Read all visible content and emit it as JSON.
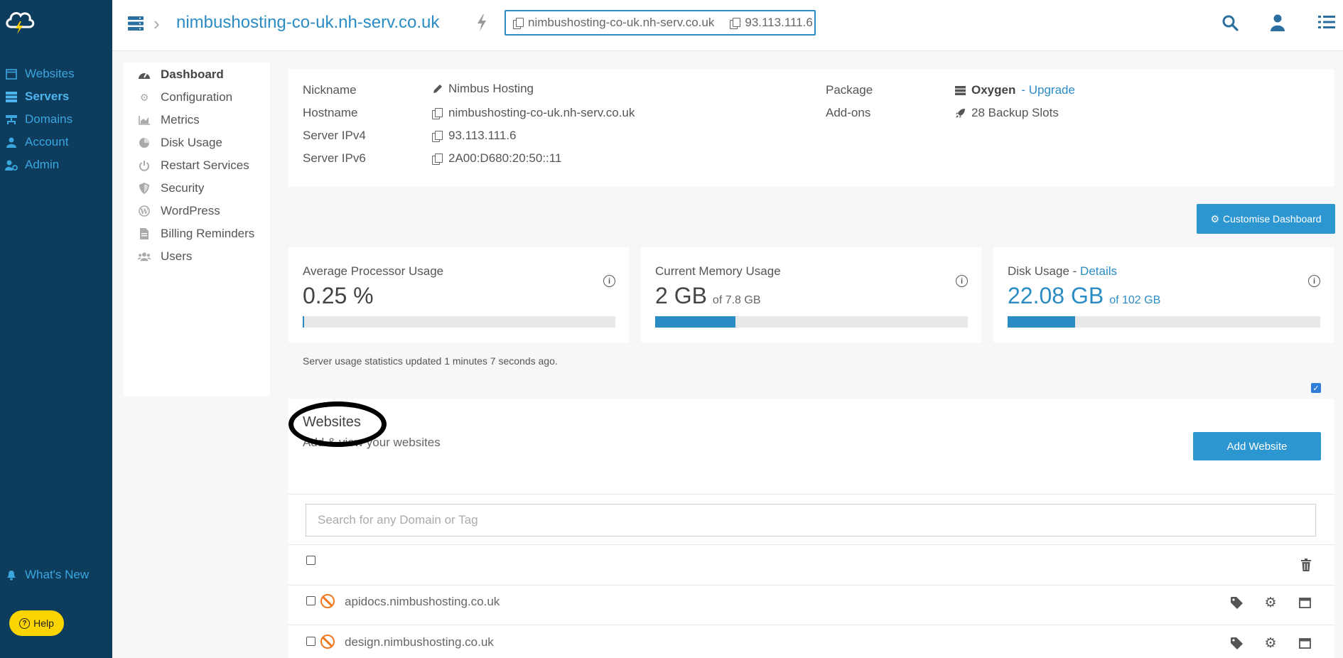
{
  "colors": {
    "nav_bg": "#0d3c5c",
    "accent": "#2b8cc4",
    "help": "#fcd500",
    "warning": "#f07820"
  },
  "leftnav": {
    "items": [
      {
        "label": "Websites",
        "icon": "browser-icon"
      },
      {
        "label": "Servers",
        "icon": "server-icon",
        "active": true
      },
      {
        "label": "Domains",
        "icon": "sitemap-icon"
      },
      {
        "label": "Account",
        "icon": "user-icon"
      },
      {
        "label": "Admin",
        "icon": "user-cog-icon"
      }
    ],
    "whats_new": "What's New",
    "help": "Help"
  },
  "topbar": {
    "title": "nimbushosting-co-uk.nh-serv.co.uk",
    "copy_hostname": "nimbushosting-co-uk.nh-serv.co.uk",
    "copy_ip": "93.113.111.6"
  },
  "subnav": {
    "items": [
      {
        "label": "Dashboard",
        "icon": "gauge-icon",
        "active": true
      },
      {
        "label": "Configuration",
        "icon": "cogs-icon"
      },
      {
        "label": "Metrics",
        "icon": "chart-area-icon"
      },
      {
        "label": "Disk Usage",
        "icon": "pie-chart-icon"
      },
      {
        "label": "Restart Services",
        "icon": "power-icon"
      },
      {
        "label": "Security",
        "icon": "shield-icon"
      },
      {
        "label": "WordPress",
        "icon": "wordpress-icon"
      },
      {
        "label": "Billing Reminders",
        "icon": "invoice-icon"
      },
      {
        "label": "Users",
        "icon": "users-icon"
      }
    ]
  },
  "info": {
    "nickname_label": "Nickname",
    "nickname": "Nimbus Hosting",
    "hostname_label": "Hostname",
    "hostname": "nimbushosting-co-uk.nh-serv.co.uk",
    "ipv4_label": "Server IPv4",
    "ipv4": "93.113.111.6",
    "ipv6_label": "Server IPv6",
    "ipv6": "2A00:D680:20:50::11",
    "package_label": "Package",
    "package": "Oxygen",
    "upgrade": "- Upgrade",
    "addons_label": "Add-ons",
    "addons": "28 Backup Slots"
  },
  "customise_button": "Customise Dashboard",
  "stats": {
    "cpu": {
      "title": "Average Processor Usage",
      "value": "0.25 %",
      "fill": 0.0025
    },
    "memory": {
      "title": "Current Memory Usage",
      "value": "2 GB",
      "of": "of 7.8 GB",
      "fill": 0.256
    },
    "disk": {
      "title_prefix": "Disk Usage -",
      "details": "Details",
      "value": "22.08 GB",
      "of": "of 102 GB",
      "fill": 0.2165
    },
    "note": "Server usage statistics updated 1 minutes 7 seconds ago."
  },
  "websites": {
    "title": "Websites",
    "subtitle": "Add & view your websites",
    "add_button": "Add Website",
    "search_placeholder": "Search for any Domain or Tag",
    "rows": [
      {
        "domain": "apidocs.nimbushosting.co.uk"
      },
      {
        "domain": "design.nimbushosting.co.uk"
      }
    ]
  }
}
